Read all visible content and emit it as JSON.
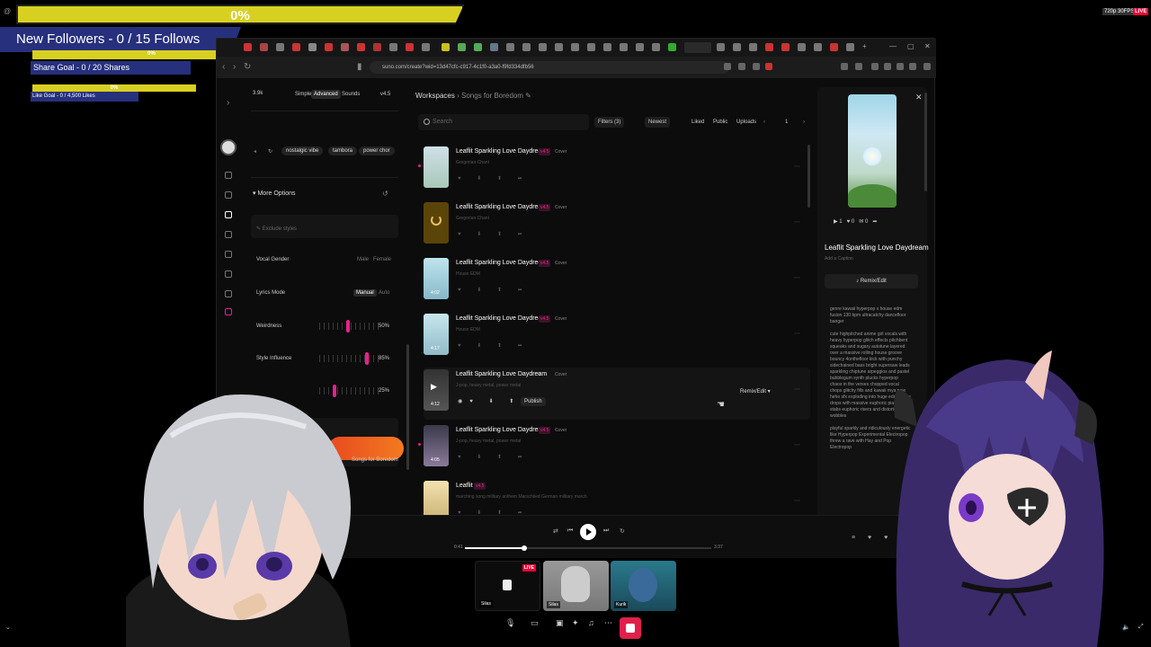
{
  "overlay": {
    "follow_pct": "0%",
    "follow_label": "New Followers - 0 / 15 Follows",
    "share_pct": "0%",
    "share_label": "Share Goal - 0 / 20 Shares",
    "like_pct": "0%",
    "like_label": "Like Goal - 0 / 4,500 Likes",
    "resolution": "720p 30FPS",
    "live": "LIVE",
    "corner": "@"
  },
  "browser": {
    "url": "suno.com/create?wid=13d47cfc-c917-4c1f0-a3a0-f9fd334dfb56"
  },
  "create": {
    "credits": "3.9k",
    "modes": [
      "Simple",
      "Advanced",
      "Sounds"
    ],
    "version": "v4.5",
    "tags": [
      "nostalgic vibe",
      "tambora",
      "power chor"
    ],
    "more_options": "More Options",
    "exclude_placeholder": "Exclude styles",
    "vocal_gender_label": "Vocal Gender",
    "vocal_gender_options": [
      "Male",
      "Female"
    ],
    "lyrics_mode_label": "Lyrics Mode",
    "lyrics_mode_options": [
      "Manual",
      "Auto"
    ],
    "weirdness_label": "Weirdness",
    "weirdness_value": "50%",
    "weirdness_level": 0.5,
    "style_influence_label": "Style Influence",
    "style_influence_value": "85%",
    "style_influence_level": 0.85,
    "audio_influence_value": "25%",
    "audio_influence_level": 0.25,
    "workspace_hint": "Songs for Boredom"
  },
  "library": {
    "crumb_root": "Workspaces",
    "crumb_current": "Songs for Boredom",
    "search_placeholder": "Search",
    "filters_label": "Filters (3)",
    "sort_label": "Newest",
    "tab_liked": "Liked",
    "tab_public": "Public",
    "tab_uploads": "Uploads",
    "page": "1",
    "songs": [
      {
        "title": "Leaflit Sparkling Love Daydream",
        "badge": "v4.5",
        "kind": "Cover",
        "style": "Gregorian Chant",
        "duration": ""
      },
      {
        "title": "Leaflit Sparkling Love Daydream",
        "badge": "v4.5",
        "kind": "Cover",
        "style": "Gregorian Chant",
        "duration": ""
      },
      {
        "title": "Leaflit Sparkling Love Daydream",
        "badge": "v4.5",
        "kind": "Cover",
        "style": "House EDM",
        "duration": "4:02"
      },
      {
        "title": "Leaflit Sparkling Love Daydream",
        "badge": "v4.5",
        "kind": "Cover",
        "style": "House EDM",
        "duration": "4:17"
      },
      {
        "title": "Leaflit Sparkling Love Daydream",
        "badge": "",
        "kind": "Cover",
        "style": "J-pop, heavy metal, power metal",
        "duration": "4:12"
      },
      {
        "title": "Leaflit Sparkling Love Daydream",
        "badge": "v4.5",
        "kind": "Cover",
        "style": "J-pop, heavy metal, power metal",
        "duration": "4:05"
      },
      {
        "title": "Leaflit",
        "badge": "v4.5",
        "kind": "",
        "style": "marching song military anthem Marschlied German military march",
        "duration": ""
      }
    ],
    "publish_label": "Publish",
    "remix_label": "Remix/Edit"
  },
  "detail": {
    "plays": "1",
    "likes": "0",
    "comments": "0",
    "title": "Leaflit Sparkling Love Daydream",
    "caption_placeholder": "Add a Caption",
    "remix_label": "Remix/Edit",
    "lyrics": "genre kawaii hyperpop x house edm fusion 130 bpm ultracatchy dancefloor banger\n\ncute highpitched anime girl vocals with heavy hyperpop glitch effects pitchbent squeaks and sugary autotune layered over a massive rolling house groove bouncy 4onthefloor kick with punchy sidechained bass bright supersaw leads sparkling chiptune arpeggios and pastel bubblegum synth plucks hyperpop chaos in the verses chopped vocal chops glitchy fills and kawaii mya pew hehe sfx exploding into huge edm house drops with massive euphoric piano stabs euphoric risers and distorted bass wobbles\n\nplayful sparkly and ridiculously energetic like Hyperpop Experimental Electropop threw a rave with Hay and Pop Electropop"
  },
  "player": {
    "time_current": "0:41",
    "time_total": "3:37",
    "progress": 0.24
  },
  "call": {
    "tiles": [
      "Silas",
      "Silas",
      "Kurik"
    ],
    "live": "LIVE"
  }
}
